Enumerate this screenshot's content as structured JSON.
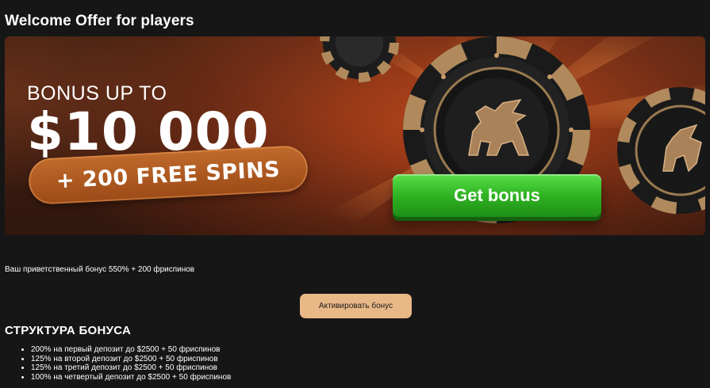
{
  "page": {
    "title": "Welcome Offer for players"
  },
  "banner": {
    "bonus_up_to": "BONUS UP TO",
    "amount": "$10 000",
    "free_spins": "+ 200 FREE SPINS",
    "get_bonus_label": "Get bonus"
  },
  "offer": {
    "description": "Ваш приветственный бонус 550% + 200 фриспинов",
    "activate_label": "Активировать бонус"
  },
  "structure": {
    "title": "СТРУКТУРА БОНУСА",
    "items": [
      "200% на первый депозит до $2500 + 50 фриспинов",
      "125% на второй депозит до $2500 + 50 фриспинов",
      "125% на третий депозит до $2500 + 50 фриспинов",
      "100% на четвертый депозит до $2500 + 50 фриспинов"
    ]
  },
  "colors": {
    "background": "#161616",
    "banner_orange": "#9a3918",
    "get_bonus_green": "#2fb322",
    "activate_button": "#e9b887",
    "chip_gold": "#b08a5c"
  }
}
